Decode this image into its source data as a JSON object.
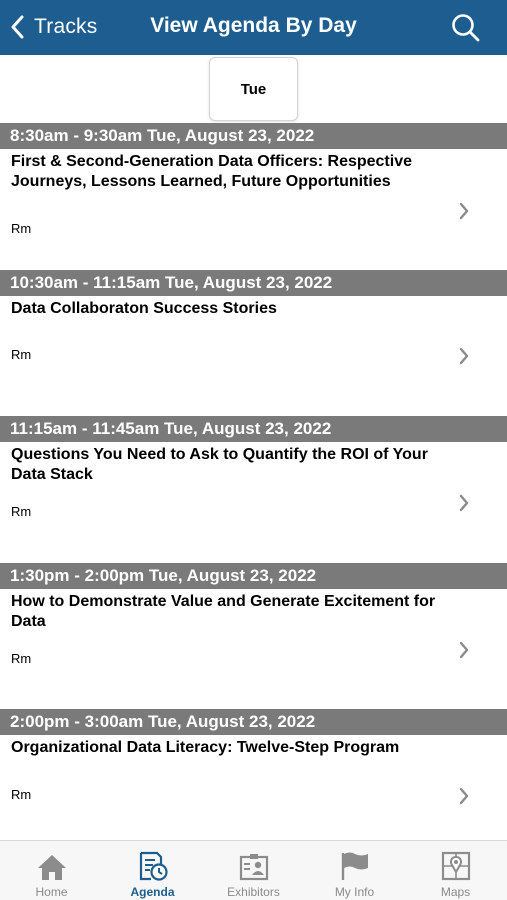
{
  "header": {
    "back_label": "Tracks",
    "title": "View Agenda By Day",
    "bar_color": "#1e5d8f",
    "icons": {
      "back": "chevron-left-icon",
      "search": "search-icon"
    }
  },
  "day_tabs": [
    {
      "label": "Tue",
      "selected": true
    }
  ],
  "sessions": [
    {
      "time": "8:30am - 9:30am Tue, August 23, 2022",
      "title": "First & Second-Generation Data Officers: Respective Journeys, Lessons Learned, Future Opportunities",
      "room": "Rm"
    },
    {
      "time": "10:30am - 11:15am Tue, August 23, 2022",
      "title": "Data Collaboraton Success Stories",
      "room": "Rm"
    },
    {
      "time": "11:15am - 11:45am Tue, August 23, 2022",
      "title": "Questions You Need to Ask to Quantify the ROI of Your Data Stack",
      "room": "Rm"
    },
    {
      "time": "1:30pm - 2:00pm Tue, August 23, 2022",
      "title": "How to Demonstrate Value and Generate Excitement for Data",
      "room": "Rm"
    },
    {
      "time": "2:00pm - 3:00am Tue, August 23, 2022",
      "title": "Organizational Data Literacy: Twelve-Step Program",
      "room": "Rm"
    }
  ],
  "tab_bar": {
    "active": "Agenda",
    "active_color": "#1e5d8f",
    "items": [
      {
        "label": "Home",
        "icon": "home-icon"
      },
      {
        "label": "Agenda",
        "icon": "agenda-icon"
      },
      {
        "label": "Exhibitors",
        "icon": "exhibitors-icon"
      },
      {
        "label": "My Info",
        "icon": "flag-icon"
      },
      {
        "label": "Maps",
        "icon": "map-icon"
      }
    ]
  }
}
